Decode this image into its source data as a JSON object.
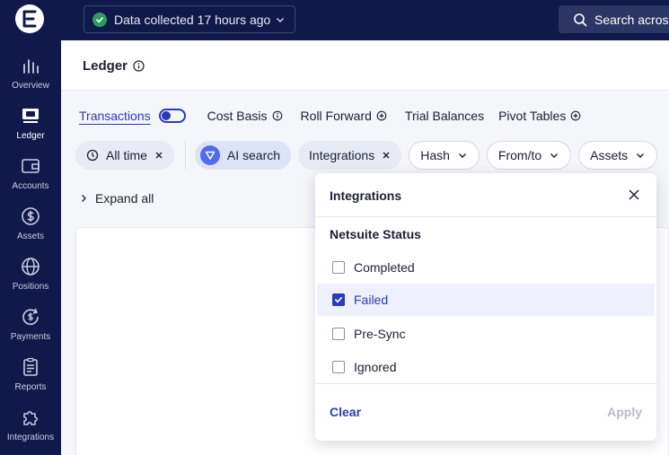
{
  "sidebar": {
    "items": [
      {
        "label": "Overview",
        "icon": "bar-chart-icon"
      },
      {
        "label": "Ledger",
        "icon": "ledger-icon",
        "active": true
      },
      {
        "label": "Accounts",
        "icon": "wallet-icon"
      },
      {
        "label": "Assets",
        "icon": "dollar-circle-icon"
      },
      {
        "label": "Positions",
        "icon": "globe-icon"
      },
      {
        "label": "Payments",
        "icon": "payments-icon"
      },
      {
        "label": "Reports",
        "icon": "clipboard-icon"
      },
      {
        "label": "Integrations",
        "icon": "puzzle-icon"
      }
    ]
  },
  "topbar": {
    "status": "Data collected 17 hours ago",
    "search_label": "Search across"
  },
  "header": {
    "title": "Ledger"
  },
  "tabs": {
    "transactions": "Transactions",
    "cost_basis": "Cost Basis",
    "roll_forward": "Roll Forward",
    "trial_balances": "Trial Balances",
    "pivot_tables": "Pivot Tables"
  },
  "filters": {
    "all_time": "All time",
    "ai_search": "AI search",
    "integrations": "Integrations",
    "hash": "Hash",
    "from_to": "From/to",
    "assets": "Assets"
  },
  "expand_all": "Expand all",
  "dropdown": {
    "title": "Integrations",
    "section": "Netsuite Status",
    "options": [
      {
        "label": "Completed",
        "checked": false
      },
      {
        "label": "Failed",
        "checked": true
      },
      {
        "label": "Pre-Sync",
        "checked": false
      },
      {
        "label": "Ignored",
        "checked": false
      }
    ],
    "clear": "Clear",
    "apply": "Apply"
  },
  "colors": {
    "sidebar_bg": "#101a4a",
    "accent": "#2a3ab8",
    "success": "#2f9e5a"
  }
}
